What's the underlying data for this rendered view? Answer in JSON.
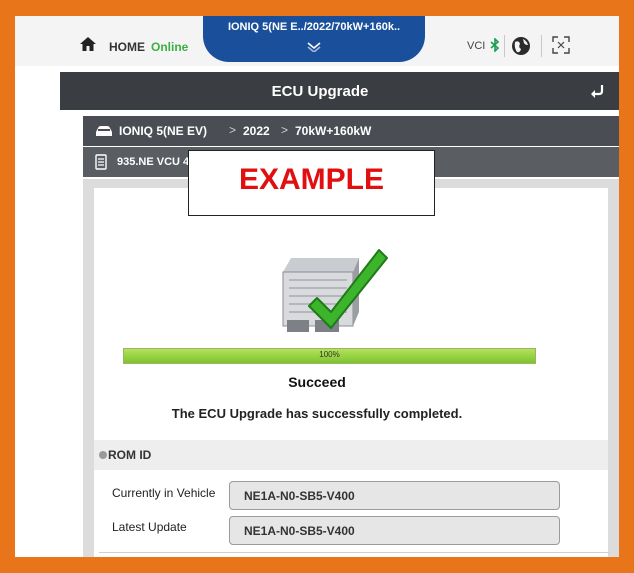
{
  "topbar": {
    "home_label": "HOME",
    "status": "Online",
    "vehicle_tab": "IONIQ 5(NE E../2022/70kW+160k..",
    "vci_label": "VCI"
  },
  "header": {
    "title": "ECU Upgrade"
  },
  "breadcrumb": {
    "items": [
      "IONIQ 5(NE EV)",
      "2022",
      "70kW+160kW"
    ],
    "separator": ">"
  },
  "ecu": {
    "label": "935.NE VCU 4"
  },
  "watermark": {
    "text": "EXAMPLE"
  },
  "progress": {
    "value": 1.0,
    "label": "100%"
  },
  "result": {
    "status": "Succeed",
    "message": "The ECU Upgrade has successfully completed."
  },
  "rom": {
    "section_title": "ROM ID",
    "fields": [
      {
        "label": "Currently in Vehicle",
        "value": "NE1A-N0-SB5-V400"
      },
      {
        "label": "Latest Update",
        "value": "NE1A-N0-SB5-V400"
      }
    ]
  },
  "colors": {
    "frame": "#e8751a",
    "tab": "#1a4f9c",
    "online": "#3cb043",
    "watermark": "#e10f0f",
    "progress": "#7cc42e"
  }
}
